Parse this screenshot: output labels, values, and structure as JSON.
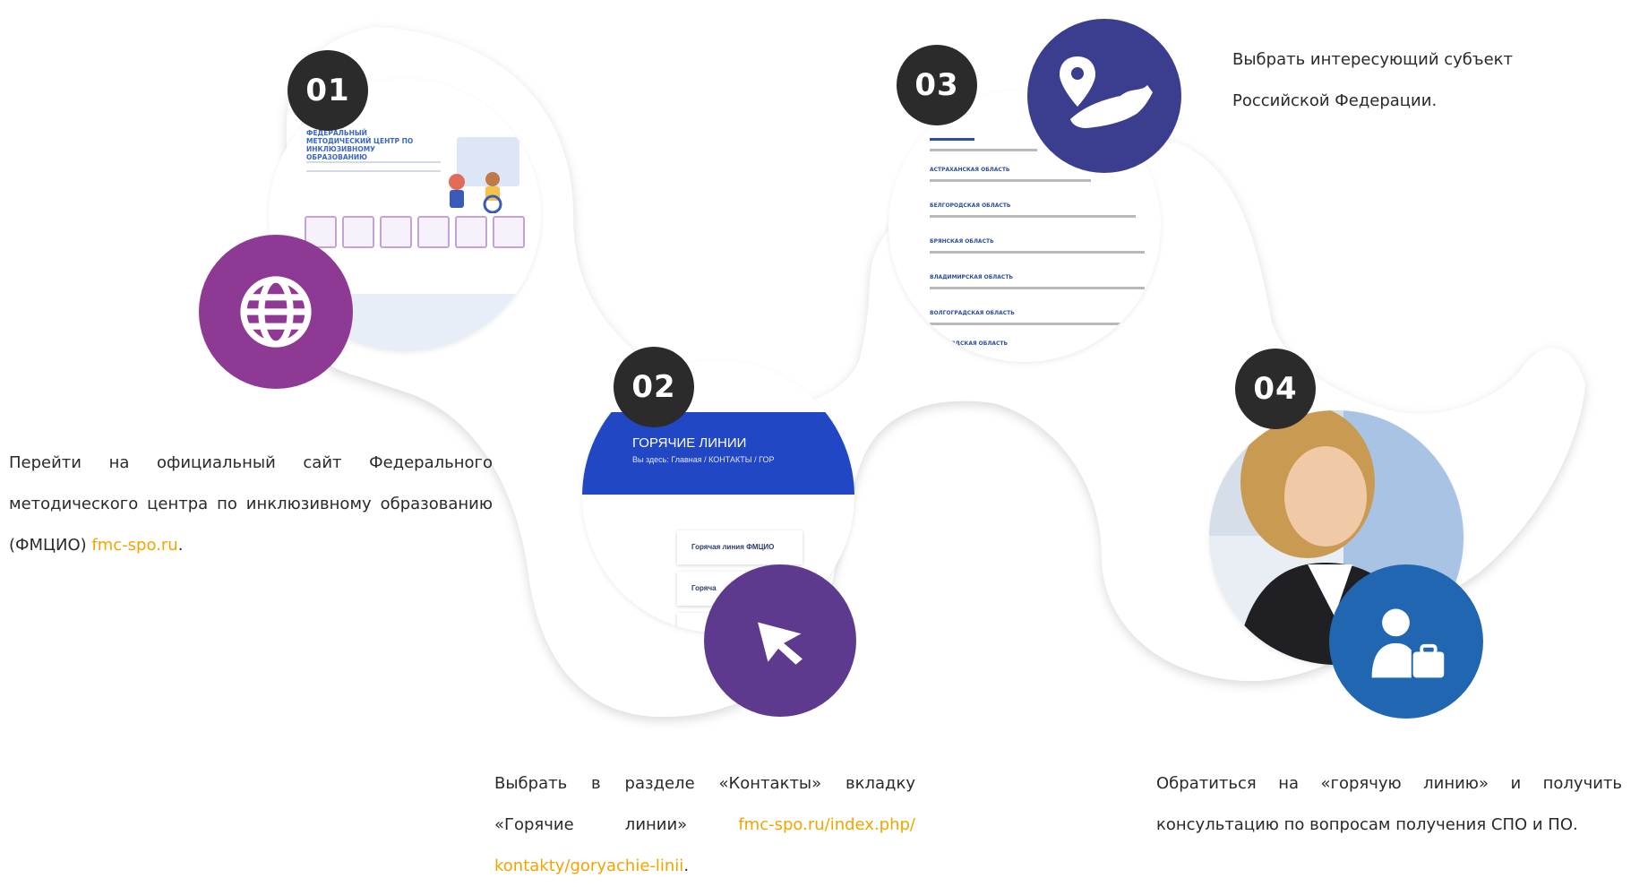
{
  "steps": [
    {
      "number": "01",
      "screenshot_title": "ФЕДЕРАЛЬНЫЙ МЕТОДИЧЕСКИЙ ЦЕНТР ПО ИНКЛЮЗИВНОМУ ОБРАЗОВАНИЮ",
      "icon": "globe-icon",
      "icon_color": "#8e3a94",
      "text": "Перейти на официальный сайт Федерального методического центра по инклюзивному образованию (ФМЦИО) ",
      "link": "fmc-spo.ru",
      "suffix": "."
    },
    {
      "number": "02",
      "screenshot_heading": "ГОРЯЧИЕ ЛИНИИ",
      "screenshot_breadcrumb": "Вы здесь: Главная / КОНТАКТЫ / ГОР",
      "screenshot_card1": "Горячая линия ФМЦИО",
      "screenshot_card2": "Горяча",
      "icon": "cursor-icon",
      "icon_color": "#5e3a8f",
      "text": "Выбрать в разделе «Контакты» вкладку «Горячие линии» ",
      "link": "fmc-spo.ru/index.php/ kontakty/goryachie-linii",
      "suffix": "."
    },
    {
      "number": "03",
      "screenshot_regions": [
        "АСТРАХАНСКАЯ ОБЛАСТЬ",
        "БЕЛГОРОДСКАЯ ОБЛАСТЬ",
        "БРЯНСКАЯ ОБЛАСТЬ",
        "ВЛАДИМИРСКАЯ ОБЛАСТЬ",
        "ВОЛГОГРАДСКАЯ ОБЛАСТЬ",
        "ВОЛОГОДСКАЯ ОБЛАСТЬ"
      ],
      "icon": "map-pin-icon",
      "icon_color": "#3b3e8f",
      "text_line1": "Выбрать интересующий субъект",
      "text_line2": "Российской Федерации."
    },
    {
      "number": "04",
      "icon": "consultant-icon",
      "icon_color": "#2166b0",
      "text": "Обратиться на «горячую линию» и получить консультацию по вопросам получения СПО и ПО."
    }
  ],
  "colors": {
    "link": "#f0a500",
    "number_badge": "#2b2b2b",
    "ribbon_shadow": "#cfcfcf"
  }
}
